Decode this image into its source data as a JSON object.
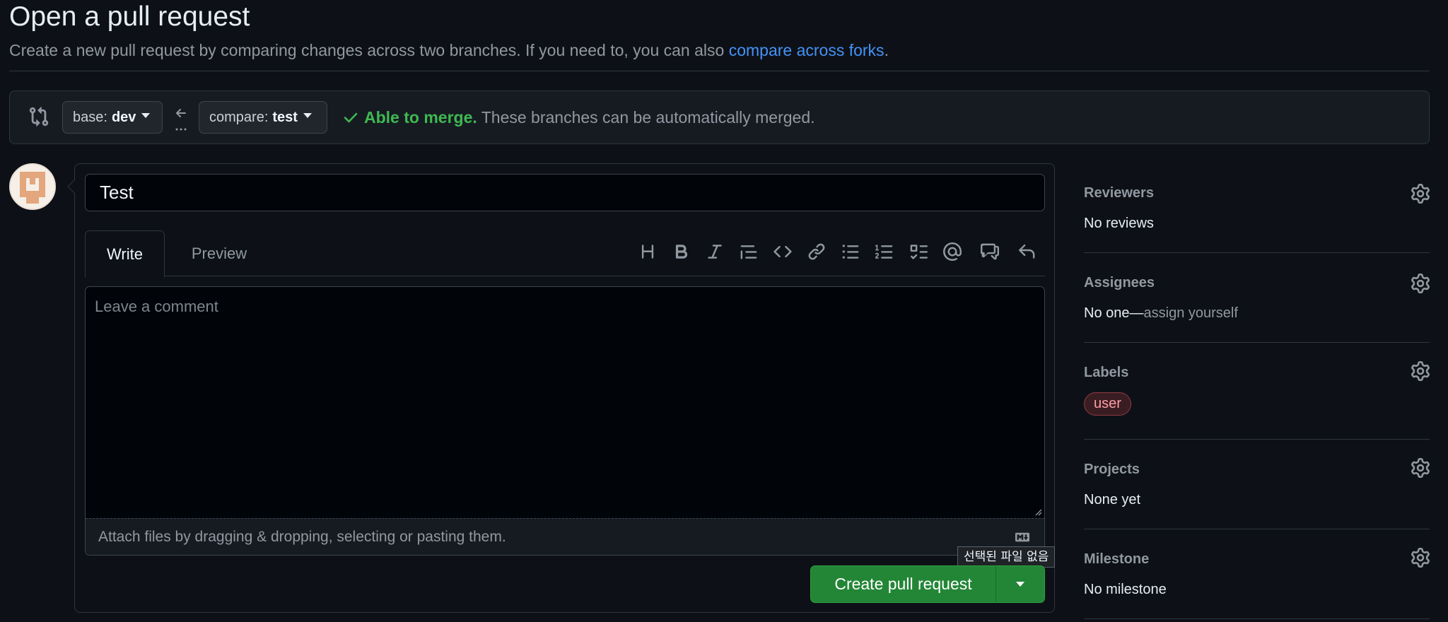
{
  "header": {
    "title": "Open a pull request",
    "subtitle_text": "Create a new pull request by comparing changes across two branches. If you need to, you can also ",
    "subtitle_link": "compare across forks",
    "subtitle_end": "."
  },
  "range": {
    "base_label": "base:",
    "base_value": "dev",
    "compare_label": "compare:",
    "compare_value": "test",
    "merge_ok": "Able to merge.",
    "merge_msg": " These branches can be automatically merged."
  },
  "form": {
    "title_value": "Test",
    "tabs": [
      {
        "label": "Write",
        "active": true
      },
      {
        "label": "Preview",
        "active": false
      }
    ],
    "toolbar_icons": [
      "heading-icon",
      "bold-icon",
      "italic-icon",
      "quote-icon",
      "code-icon",
      "link-icon",
      "unordered-list-icon",
      "ordered-list-icon",
      "task-list-icon",
      "mention-icon",
      "cross-reference-icon",
      "reply-icon"
    ],
    "comment_placeholder": "Leave a comment",
    "attach_text": "Attach files by dragging & dropping, selecting or pasting them.",
    "file_tooltip": "선택된 파일 없음",
    "submit_label": "Create pull request"
  },
  "sidebar": {
    "reviewers": {
      "heading": "Reviewers",
      "value": "No reviews"
    },
    "assignees": {
      "heading": "Assignees",
      "value": "No one—",
      "action": "assign yourself"
    },
    "labels": {
      "heading": "Labels",
      "items": [
        "user"
      ],
      "item_color": "#ff9ea5"
    },
    "projects": {
      "heading": "Projects",
      "value": "None yet"
    },
    "milestone": {
      "heading": "Milestone",
      "value": "No milestone"
    }
  },
  "colors": {
    "background": "#0d1117",
    "accent_link": "#4493f8",
    "success": "#3fb950",
    "primary_button": "#238636"
  }
}
